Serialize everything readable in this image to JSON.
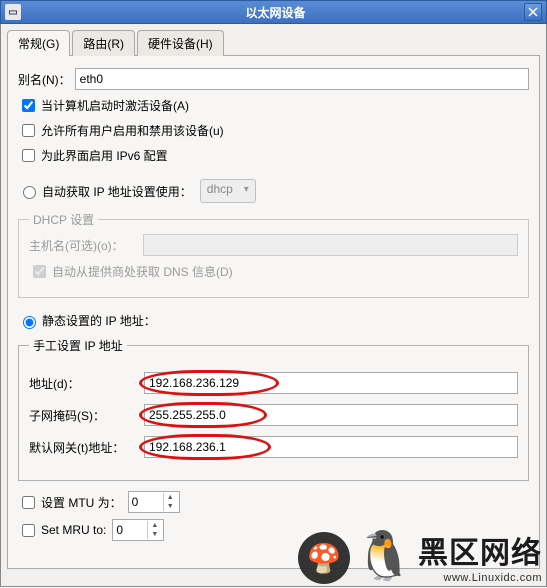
{
  "window": {
    "title": "以太网设备"
  },
  "tabs": {
    "general": "常规(G)",
    "route": "路由(R)",
    "hardware": "硬件设备(H)"
  },
  "alias": {
    "label": "别名(N)：",
    "value": "eth0"
  },
  "checks": {
    "activate_on_boot": "当计算机启动时激活设备(A)",
    "allow_users": "允许所有用户启用和禁用该设备(u)",
    "enable_ipv6": "为此界面启用 IPv6 配置"
  },
  "auto": {
    "label": "自动获取 IP 地址设置使用：",
    "dropdown": "dhcp"
  },
  "dhcp": {
    "legend": "DHCP 设置",
    "hostname_label": "主机名(可选)(o)：",
    "hostname_value": "",
    "auto_dns": "自动从提供商处获取 DNS 信息(D)"
  },
  "static": {
    "label": "静态设置的 IP 地址："
  },
  "manual": {
    "legend": "手工设置 IP 地址",
    "address_label": "地址(d)：",
    "address_value": "192.168.236.129",
    "subnet_label": "子网掩码(S)：",
    "subnet_value": "255.255.255.0",
    "gateway_label": "默认网关(t)地址：",
    "gateway_value": "192.168.236.1"
  },
  "mtu": {
    "label": "设置 MTU 为：",
    "value": "0"
  },
  "mru": {
    "label": "Set MRU to:",
    "value": "0"
  },
  "watermark": {
    "line1": "黑区网络",
    "line2": "www.Linuxidc.com"
  }
}
